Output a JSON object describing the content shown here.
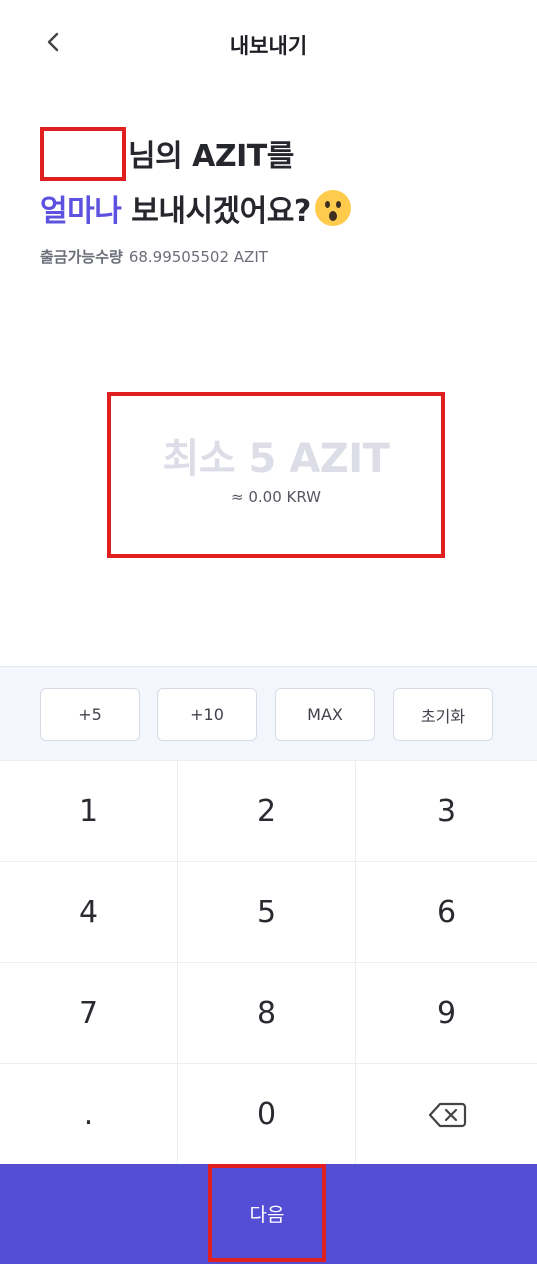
{
  "header": {
    "title": "내보내기",
    "back_icon": "chevron-left-icon"
  },
  "prompt": {
    "line1_suffix": "님의 AZIT를",
    "line2_accent": "얼마나",
    "line2_rest": " 보내시겠어요?",
    "emoji": "hushed-face-icon"
  },
  "available": {
    "label": "출금가능수량",
    "value": "68.99505502 AZIT"
  },
  "amount": {
    "placeholder": "최소 5 AZIT",
    "fiat": "≈ 0.00 KRW"
  },
  "quick_buttons": [
    "+5",
    "+10",
    "MAX",
    "초기화"
  ],
  "keypad": {
    "rows": [
      [
        "1",
        "2",
        "3"
      ],
      [
        "4",
        "5",
        "6"
      ],
      [
        "7",
        "8",
        "9"
      ],
      [
        ".",
        "0",
        ""
      ]
    ],
    "backspace_icon": "backspace-icon"
  },
  "next_button": {
    "label": "다음"
  },
  "colors": {
    "accent": "#5d52e0",
    "primary_button": "#544ed4",
    "highlight_border": "#e02020"
  }
}
